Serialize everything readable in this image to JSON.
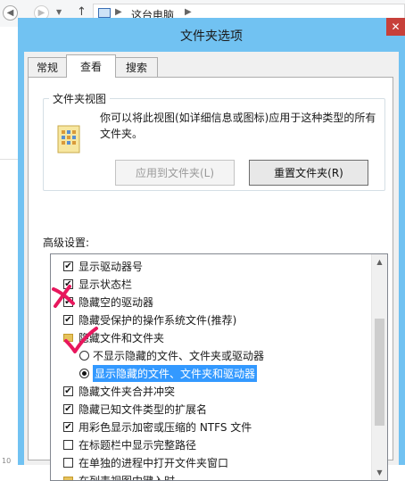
{
  "explorer": {
    "path": "这台电脑",
    "left_num": "10"
  },
  "dialog": {
    "title": "文件夹选项",
    "close_glyph": "✕",
    "tabs": [
      {
        "label": "常规",
        "active": false
      },
      {
        "label": "查看",
        "active": true
      },
      {
        "label": "搜索",
        "active": false
      }
    ],
    "folder_view": {
      "title": "文件夹视图",
      "description": "你可以将此视图(如详细信息或图标)应用于这种类型的所有文件夹。",
      "apply_button": "应用到文件夹(L)",
      "reset_button": "重置文件夹(R)"
    },
    "advanced_label": "高级设置:",
    "tree_items": [
      {
        "type": "checkbox",
        "label": "显示驱动器号",
        "checked": true
      },
      {
        "type": "checkbox",
        "label": "显示状态栏",
        "checked": true
      },
      {
        "type": "checkbox",
        "label": "隐藏空的驱动器",
        "checked": true
      },
      {
        "type": "checkbox",
        "label": "隐藏受保护的操作系统文件(推荐)",
        "checked": true
      },
      {
        "type": "folder",
        "label": "隐藏文件和文件夹"
      },
      {
        "type": "radio",
        "label": "不显示隐藏的文件、文件夹或驱动器",
        "checked": false
      },
      {
        "type": "radio",
        "label": "显示隐藏的文件、文件夹和驱动器",
        "checked": true,
        "selected": true
      },
      {
        "type": "checkbox",
        "label": "隐藏文件夹合并冲突",
        "checked": true
      },
      {
        "type": "checkbox",
        "label": "隐藏已知文件类型的扩展名",
        "checked": true
      },
      {
        "type": "checkbox",
        "label": "用彩色显示加密或压缩的 NTFS 文件",
        "checked": true
      },
      {
        "type": "checkbox",
        "label": "在标题栏中显示完整路径",
        "checked": false
      },
      {
        "type": "checkbox",
        "label": "在单独的进程中打开文件夹窗口",
        "checked": false
      },
      {
        "type": "folder",
        "label": "在列表视图中键入时"
      }
    ],
    "scroll": {
      "up": "▲",
      "down": "▼"
    }
  },
  "colors": {
    "title_bar": "#71c2f2",
    "close": "#c7403a",
    "selection": "#3399ff",
    "annotation": "#e8175d"
  }
}
